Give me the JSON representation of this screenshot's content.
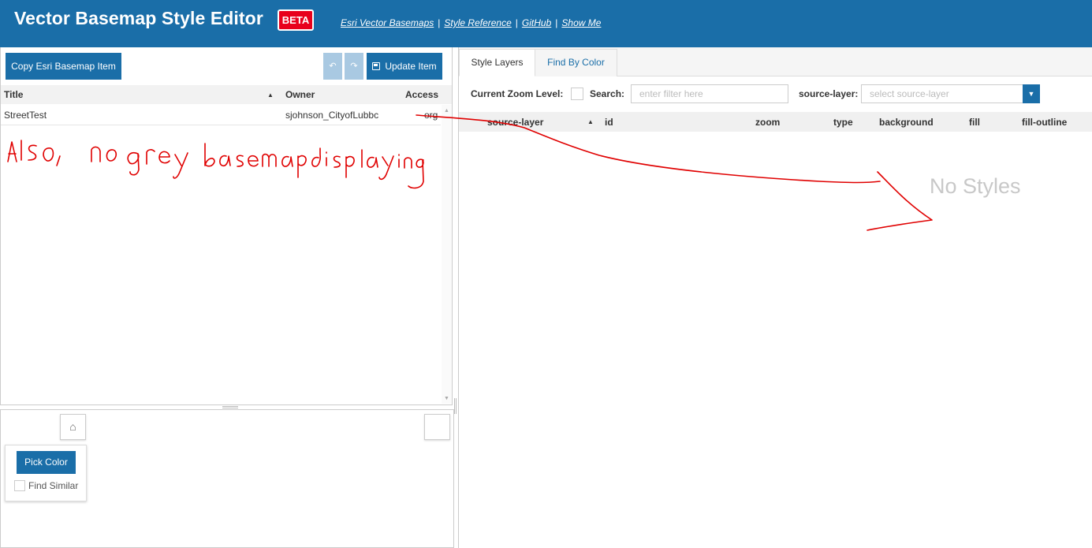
{
  "header": {
    "title": "Vector Basemap Style Editor",
    "badge": "BETA",
    "links": [
      "Esri Vector Basemaps",
      "Style Reference",
      "GitHub",
      "Show Me"
    ],
    "separator": "|"
  },
  "left_panel": {
    "copy_button": "Copy Esri Basemap Item",
    "undo_icon": "↶",
    "redo_icon": "↷",
    "update_button": "Update Item",
    "columns": {
      "title": "Title",
      "owner": "Owner",
      "access": "Access"
    },
    "sort_indicator": "▲",
    "rows": [
      {
        "title": "StreetTest",
        "owner": "sjohnson_CityofLubbc",
        "access": "org"
      }
    ]
  },
  "map": {
    "home_icon": "⌂",
    "pick_button": "Pick Color",
    "find_similar": "Find Similar"
  },
  "right_panel": {
    "tabs": [
      "Style Layers",
      "Find By Color"
    ],
    "zoom_label": "Current Zoom Level:",
    "search_label": "Search:",
    "search_placeholder": "enter filter here",
    "source_label": "source-layer:",
    "source_placeholder": "select source-layer",
    "columns": [
      "source-layer",
      "id",
      "zoom",
      "type",
      "background",
      "fill",
      "fill-outline"
    ],
    "sort_indicator": "▲",
    "empty_message": "No Styles"
  },
  "annotation": {
    "handwritten_text": "Also, no grey basemap displaying",
    "color": "#e00000"
  },
  "colors": {
    "header_bg": "#1a6ea8",
    "badge_bg": "#e8001c",
    "button_bg": "#1a6ea8",
    "button_disabled_bg": "#a9c9e2"
  }
}
